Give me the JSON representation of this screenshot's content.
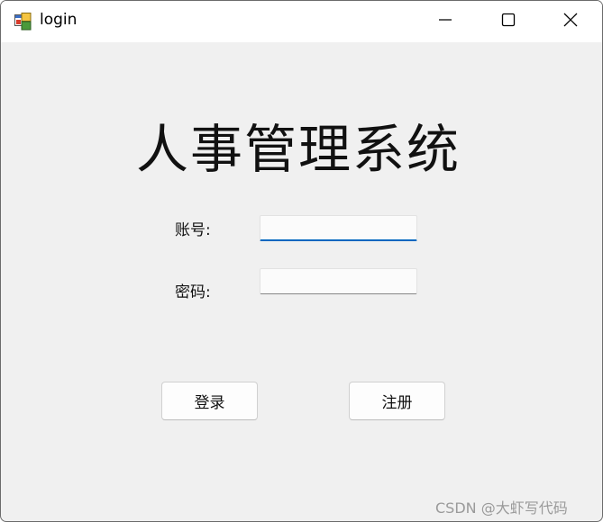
{
  "window": {
    "title": "login",
    "icon": "app-window-icon",
    "controls": {
      "minimize_icon": "minimize-icon",
      "maximize_icon": "maximize-icon",
      "close_icon": "close-icon"
    }
  },
  "form": {
    "heading": "人事管理系统",
    "account_label": "账号:",
    "account_value": "",
    "password_label": "密码:",
    "password_value": "",
    "login_button": "登录",
    "register_button": "注册"
  },
  "watermark": "CSDN @大虾写代码",
  "colors": {
    "focus_accent": "#0067c0",
    "window_background": "#f0f0f0",
    "titlebar_background": "#ffffff"
  }
}
